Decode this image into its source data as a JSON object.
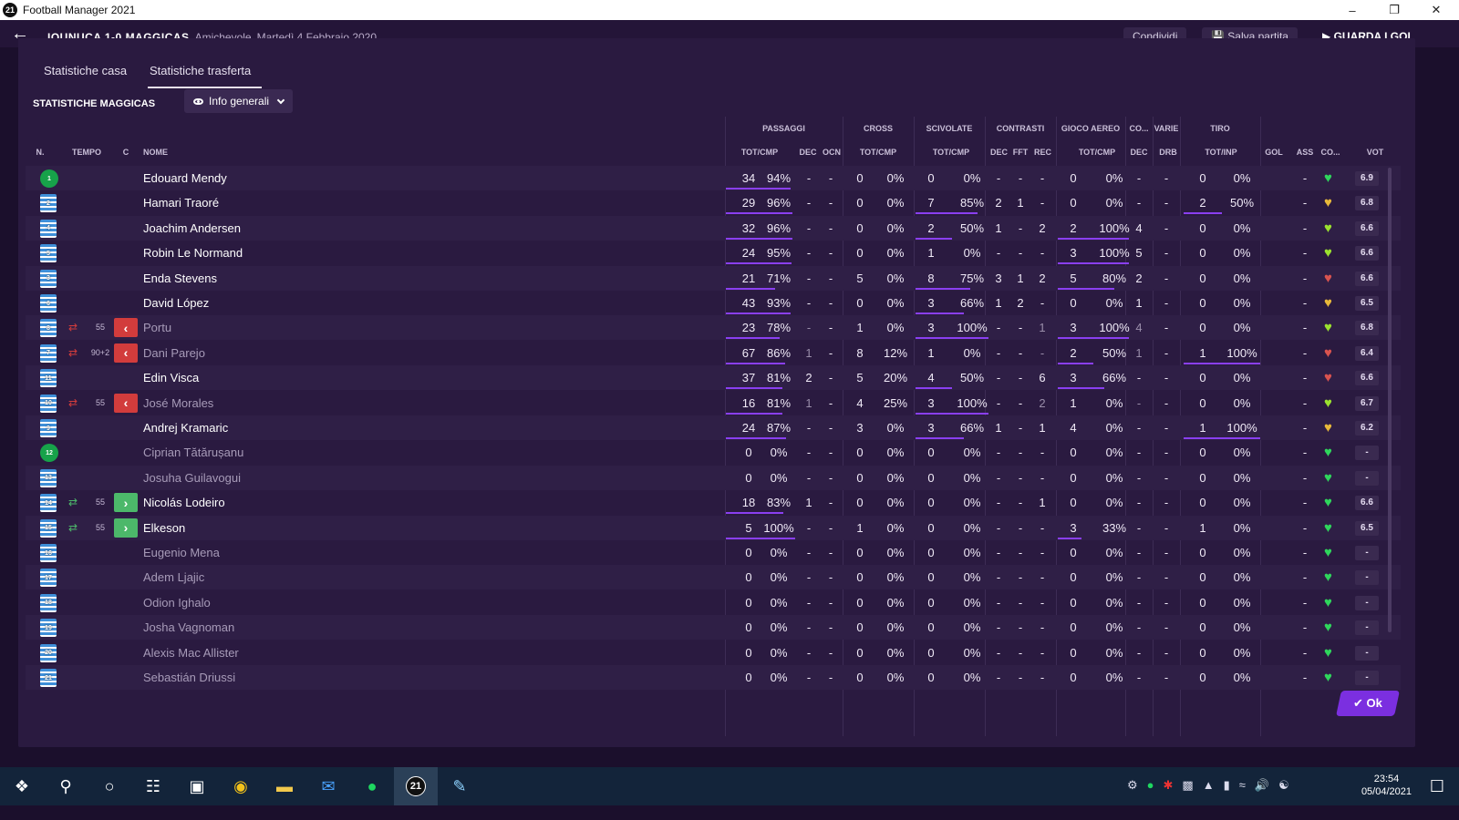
{
  "window": {
    "title": "Football Manager 2021",
    "logo": "21"
  },
  "header": {
    "match": "IQUNUCA 1-0 MAGGICAS",
    "type": "Amichevole",
    "date": "Martedì 4 Febbraio 2020",
    "share": "Condividi",
    "save": "Salva partita",
    "continue": "GUARDA I GOL"
  },
  "tabs": [
    "Statistiche casa",
    "Statistiche trasferta"
  ],
  "team_title": "STATISTICHE MAGGICAS",
  "view_dropdown": "Info generali",
  "col_groups": [
    "PASSAGGI",
    "CROSS",
    "SCIVOLATE",
    "CONTRASTI",
    "GIOCO AEREO",
    "CO...",
    "VARIE",
    "TIRO"
  ],
  "columns": [
    "N.",
    "TEMPO",
    "C",
    "NOME",
    "TOT/CMP",
    "DEC",
    "OCN",
    "TOT/CMP",
    "TOT/CMP",
    "DEC",
    "FFT",
    "REC",
    "TOT/CMP",
    "DEC",
    "DRB",
    "TOT/INP",
    "GOL",
    "ASS",
    "CO...",
    "VOT"
  ],
  "colors": {
    "pass_bar": "#8a3ff0",
    "sub_in": "#4cb86a",
    "sub_out": "#d23c3c",
    "heart_green": "#2fd65c",
    "heart_yellow": "#e8b93a",
    "heart_red": "#d9534f"
  },
  "players": [
    {
      "num": "1",
      "gk": true,
      "name": "Edouard Mendy",
      "sub": "",
      "time": "",
      "pt": "34",
      "pp": "94%",
      "pd": "-",
      "po": "-",
      "ct": "0",
      "cp": "0%",
      "st": "0",
      "sp": "0%",
      "kd": "-",
      "kf": "-",
      "kr": "-",
      "at": "0",
      "ap": "0%",
      "cd": "-",
      "vd": "-",
      "tt": "0",
      "tp": "0%",
      "gol": "",
      "ass": "-",
      "heart": "green",
      "vot": "6.9",
      "pfrac": 0.94,
      "sfrac": 0,
      "afrac": 0,
      "tfrac": 0
    },
    {
      "num": "2",
      "name": "Hamari Traoré",
      "sub": "",
      "time": "",
      "pt": "29",
      "pp": "96%",
      "pd": "-",
      "po": "-",
      "ct": "0",
      "cp": "0%",
      "st": "7",
      "sp": "85%",
      "kd": "2",
      "kf": "1",
      "kr": "-",
      "at": "0",
      "ap": "0%",
      "cd": "-",
      "vd": "-",
      "tt": "2",
      "tp": "50%",
      "gol": "",
      "ass": "-",
      "heart": "yellow",
      "vot": "6.8",
      "pfrac": 0.96,
      "sfrac": 0.85,
      "afrac": 0,
      "tfrac": 0.5
    },
    {
      "num": "4",
      "name": "Joachim Andersen",
      "sub": "",
      "time": "",
      "pt": "32",
      "pp": "96%",
      "pd": "-",
      "po": "-",
      "ct": "0",
      "cp": "0%",
      "st": "2",
      "sp": "50%",
      "kd": "1",
      "kf": "-",
      "kr": "2",
      "at": "2",
      "ap": "100%",
      "cd": "4",
      "vd": "-",
      "tt": "0",
      "tp": "0%",
      "gol": "",
      "ass": "-",
      "heart": "lime",
      "vot": "6.6",
      "pfrac": 0.96,
      "sfrac": 0.5,
      "afrac": 1,
      "tfrac": 0
    },
    {
      "num": "5",
      "name": "Robin Le Normand",
      "sub": "",
      "time": "",
      "pt": "24",
      "pp": "95%",
      "pd": "-",
      "po": "-",
      "ct": "0",
      "cp": "0%",
      "st": "1",
      "sp": "0%",
      "kd": "-",
      "kf": "-",
      "kr": "-",
      "at": "3",
      "ap": "100%",
      "cd": "5",
      "vd": "-",
      "tt": "0",
      "tp": "0%",
      "gol": "",
      "ass": "-",
      "heart": "lime",
      "vot": "6.6",
      "pfrac": 0.95,
      "sfrac": 0,
      "afrac": 1,
      "tfrac": 0
    },
    {
      "num": "3",
      "name": "Enda Stevens",
      "sub": "",
      "time": "",
      "pt": "21",
      "pp": "71%",
      "pd": "-",
      "po": "-",
      "ct": "5",
      "cp": "0%",
      "st": "8",
      "sp": "75%",
      "kd": "3",
      "kf": "1",
      "kr": "2",
      "at": "5",
      "ap": "80%",
      "cd": "2",
      "vd": "-",
      "tt": "0",
      "tp": "0%",
      "gol": "",
      "ass": "-",
      "heart": "red",
      "vot": "6.6",
      "pfrac": 0.71,
      "sfrac": 0.75,
      "afrac": 0.8,
      "tfrac": 0
    },
    {
      "num": "6",
      "name": "David López",
      "sub": "",
      "time": "",
      "pt": "43",
      "pp": "93%",
      "pd": "-",
      "po": "-",
      "ct": "0",
      "cp": "0%",
      "st": "3",
      "sp": "66%",
      "kd": "1",
      "kf": "2",
      "kr": "-",
      "at": "0",
      "ap": "0%",
      "cd": "1",
      "vd": "-",
      "tt": "0",
      "tp": "0%",
      "gol": "",
      "ass": "-",
      "heart": "yellow",
      "vot": "6.5",
      "pfrac": 0.93,
      "sfrac": 0.66,
      "afrac": 0,
      "tfrac": 0
    },
    {
      "num": "8",
      "name": "Portu",
      "sub": "out",
      "time": "55",
      "pt": "23",
      "pp": "78%",
      "pd": "-",
      "po": "-",
      "ct": "1",
      "cp": "0%",
      "st": "3",
      "sp": "100%",
      "kd": "-",
      "kf": "-",
      "kr": "1",
      "at": "3",
      "ap": "100%",
      "cd": "4",
      "vd": "-",
      "tt": "0",
      "tp": "0%",
      "gol": "",
      "ass": "-",
      "heart": "lime",
      "vot": "6.8",
      "pfrac": 0.78,
      "sfrac": 1,
      "afrac": 1,
      "tfrac": 0
    },
    {
      "num": "7",
      "name": "Dani Parejo",
      "sub": "out",
      "time": "90+2",
      "pt": "67",
      "pp": "86%",
      "pd": "1",
      "po": "-",
      "ct": "8",
      "cp": "12%",
      "st": "1",
      "sp": "0%",
      "kd": "-",
      "kf": "-",
      "kr": "-",
      "at": "2",
      "ap": "50%",
      "cd": "1",
      "vd": "-",
      "tt": "1",
      "tp": "100%",
      "gol": "",
      "ass": "-",
      "heart": "red",
      "vot": "6.4",
      "pfrac": 0.86,
      "sfrac": 0,
      "afrac": 0.5,
      "tfrac": 1
    },
    {
      "num": "11",
      "name": "Edin Visca",
      "sub": "",
      "time": "",
      "pt": "37",
      "pp": "81%",
      "pd": "2",
      "po": "-",
      "ct": "5",
      "cp": "20%",
      "st": "4",
      "sp": "50%",
      "kd": "-",
      "kf": "-",
      "kr": "6",
      "at": "3",
      "ap": "66%",
      "cd": "-",
      "vd": "-",
      "tt": "0",
      "tp": "0%",
      "gol": "",
      "ass": "-",
      "heart": "red",
      "vot": "6.6",
      "pfrac": 0.81,
      "sfrac": 0.5,
      "afrac": 0.66,
      "tfrac": 0
    },
    {
      "num": "10",
      "name": "José Morales",
      "sub": "out",
      "time": "55",
      "pt": "16",
      "pp": "81%",
      "pd": "1",
      "po": "-",
      "ct": "4",
      "cp": "25%",
      "st": "3",
      "sp": "100%",
      "kd": "-",
      "kf": "-",
      "kr": "2",
      "at": "1",
      "ap": "0%",
      "cd": "-",
      "vd": "-",
      "tt": "0",
      "tp": "0%",
      "gol": "",
      "ass": "-",
      "heart": "lime",
      "vot": "6.7",
      "pfrac": 0.81,
      "sfrac": 1,
      "afrac": 0,
      "tfrac": 0
    },
    {
      "num": "9",
      "name": "Andrej Kramaric",
      "sub": "",
      "time": "",
      "pt": "24",
      "pp": "87%",
      "pd": "-",
      "po": "-",
      "ct": "3",
      "cp": "0%",
      "st": "3",
      "sp": "66%",
      "kd": "1",
      "kf": "-",
      "kr": "1",
      "at": "4",
      "ap": "0%",
      "cd": "-",
      "vd": "-",
      "tt": "1",
      "tp": "100%",
      "gol": "",
      "ass": "-",
      "heart": "yellow",
      "vot": "6.2",
      "pfrac": 0.87,
      "sfrac": 0.66,
      "afrac": 0,
      "tfrac": 1
    },
    {
      "num": "12",
      "gk": true,
      "name": "Ciprian Tătărușanu",
      "sub": "",
      "time": "",
      "bench": true,
      "pt": "0",
      "pp": "0%",
      "pd": "-",
      "po": "-",
      "ct": "0",
      "cp": "0%",
      "st": "0",
      "sp": "0%",
      "kd": "-",
      "kf": "-",
      "kr": "-",
      "at": "0",
      "ap": "0%",
      "cd": "-",
      "vd": "-",
      "tt": "0",
      "tp": "0%",
      "gol": "",
      "ass": "-",
      "heart": "green",
      "vot": "-",
      "pfrac": 0,
      "sfrac": 0,
      "afrac": 0,
      "tfrac": 0
    },
    {
      "num": "13",
      "name": "Josuha Guilavogui",
      "sub": "",
      "time": "",
      "bench": true,
      "pt": "0",
      "pp": "0%",
      "pd": "-",
      "po": "-",
      "ct": "0",
      "cp": "0%",
      "st": "0",
      "sp": "0%",
      "kd": "-",
      "kf": "-",
      "kr": "-",
      "at": "0",
      "ap": "0%",
      "cd": "-",
      "vd": "-",
      "tt": "0",
      "tp": "0%",
      "gol": "",
      "ass": "-",
      "heart": "green",
      "vot": "-",
      "pfrac": 0,
      "sfrac": 0,
      "afrac": 0,
      "tfrac": 0
    },
    {
      "num": "14",
      "name": "Nicolás Lodeiro",
      "sub": "in",
      "time": "55",
      "pt": "18",
      "pp": "83%",
      "pd": "1",
      "po": "-",
      "ct": "0",
      "cp": "0%",
      "st": "0",
      "sp": "0%",
      "kd": "-",
      "kf": "-",
      "kr": "1",
      "at": "0",
      "ap": "0%",
      "cd": "-",
      "vd": "-",
      "tt": "0",
      "tp": "0%",
      "gol": "",
      "ass": "-",
      "heart": "green",
      "vot": "6.6",
      "pfrac": 0.83,
      "sfrac": 0,
      "afrac": 0,
      "tfrac": 0
    },
    {
      "num": "15",
      "name": "Elkeson",
      "sub": "in",
      "time": "55",
      "pt": "5",
      "pp": "100%",
      "pd": "-",
      "po": "-",
      "ct": "1",
      "cp": "0%",
      "st": "0",
      "sp": "0%",
      "kd": "-",
      "kf": "-",
      "kr": "-",
      "at": "3",
      "ap": "33%",
      "cd": "-",
      "vd": "-",
      "tt": "1",
      "tp": "0%",
      "gol": "",
      "ass": "-",
      "heart": "green",
      "vot": "6.5",
      "pfrac": 1,
      "sfrac": 0,
      "afrac": 0.33,
      "tfrac": 0
    },
    {
      "num": "16",
      "name": "Eugenio Mena",
      "sub": "",
      "time": "",
      "bench": true,
      "pt": "0",
      "pp": "0%",
      "pd": "-",
      "po": "-",
      "ct": "0",
      "cp": "0%",
      "st": "0",
      "sp": "0%",
      "kd": "-",
      "kf": "-",
      "kr": "-",
      "at": "0",
      "ap": "0%",
      "cd": "-",
      "vd": "-",
      "tt": "0",
      "tp": "0%",
      "gol": "",
      "ass": "-",
      "heart": "green",
      "vot": "-",
      "pfrac": 0,
      "sfrac": 0,
      "afrac": 0,
      "tfrac": 0
    },
    {
      "num": "17",
      "name": "Adem Ljajic",
      "sub": "",
      "time": "",
      "bench": true,
      "pt": "0",
      "pp": "0%",
      "pd": "-",
      "po": "-",
      "ct": "0",
      "cp": "0%",
      "st": "0",
      "sp": "0%",
      "kd": "-",
      "kf": "-",
      "kr": "-",
      "at": "0",
      "ap": "0%",
      "cd": "-",
      "vd": "-",
      "tt": "0",
      "tp": "0%",
      "gol": "",
      "ass": "-",
      "heart": "green",
      "vot": "-",
      "pfrac": 0,
      "sfrac": 0,
      "afrac": 0,
      "tfrac": 0
    },
    {
      "num": "18",
      "name": "Odion Ighalo",
      "sub": "",
      "time": "",
      "bench": true,
      "pt": "0",
      "pp": "0%",
      "pd": "-",
      "po": "-",
      "ct": "0",
      "cp": "0%",
      "st": "0",
      "sp": "0%",
      "kd": "-",
      "kf": "-",
      "kr": "-",
      "at": "0",
      "ap": "0%",
      "cd": "-",
      "vd": "-",
      "tt": "0",
      "tp": "0%",
      "gol": "",
      "ass": "-",
      "heart": "green",
      "vot": "-",
      "pfrac": 0,
      "sfrac": 0,
      "afrac": 0,
      "tfrac": 0
    },
    {
      "num": "19",
      "name": "Josha Vagnoman",
      "sub": "",
      "time": "",
      "bench": true,
      "pt": "0",
      "pp": "0%",
      "pd": "-",
      "po": "-",
      "ct": "0",
      "cp": "0%",
      "st": "0",
      "sp": "0%",
      "kd": "-",
      "kf": "-",
      "kr": "-",
      "at": "0",
      "ap": "0%",
      "cd": "-",
      "vd": "-",
      "tt": "0",
      "tp": "0%",
      "gol": "",
      "ass": "-",
      "heart": "green",
      "vot": "-",
      "pfrac": 0,
      "sfrac": 0,
      "afrac": 0,
      "tfrac": 0
    },
    {
      "num": "20",
      "name": "Alexis Mac Allister",
      "sub": "",
      "time": "",
      "bench": true,
      "pt": "0",
      "pp": "0%",
      "pd": "-",
      "po": "-",
      "ct": "0",
      "cp": "0%",
      "st": "0",
      "sp": "0%",
      "kd": "-",
      "kf": "-",
      "kr": "-",
      "at": "0",
      "ap": "0%",
      "cd": "-",
      "vd": "-",
      "tt": "0",
      "tp": "0%",
      "gol": "",
      "ass": "-",
      "heart": "green",
      "vot": "-",
      "pfrac": 0,
      "sfrac": 0,
      "afrac": 0,
      "tfrac": 0
    },
    {
      "num": "21",
      "name": "Sebastián Driussi",
      "sub": "",
      "time": "",
      "bench": true,
      "pt": "0",
      "pp": "0%",
      "pd": "-",
      "po": "-",
      "ct": "0",
      "cp": "0%",
      "st": "0",
      "sp": "0%",
      "kd": "-",
      "kf": "-",
      "kr": "-",
      "at": "0",
      "ap": "0%",
      "cd": "-",
      "vd": "-",
      "tt": "0",
      "tp": "0%",
      "gol": "",
      "ass": "-",
      "heart": "green",
      "vot": "-",
      "pfrac": 0,
      "sfrac": 0,
      "afrac": 0,
      "tfrac": 0
    }
  ],
  "ok_button": "Ok",
  "taskbar": {
    "time": "23:54",
    "date": "05/04/2021",
    "app_label": "21"
  }
}
